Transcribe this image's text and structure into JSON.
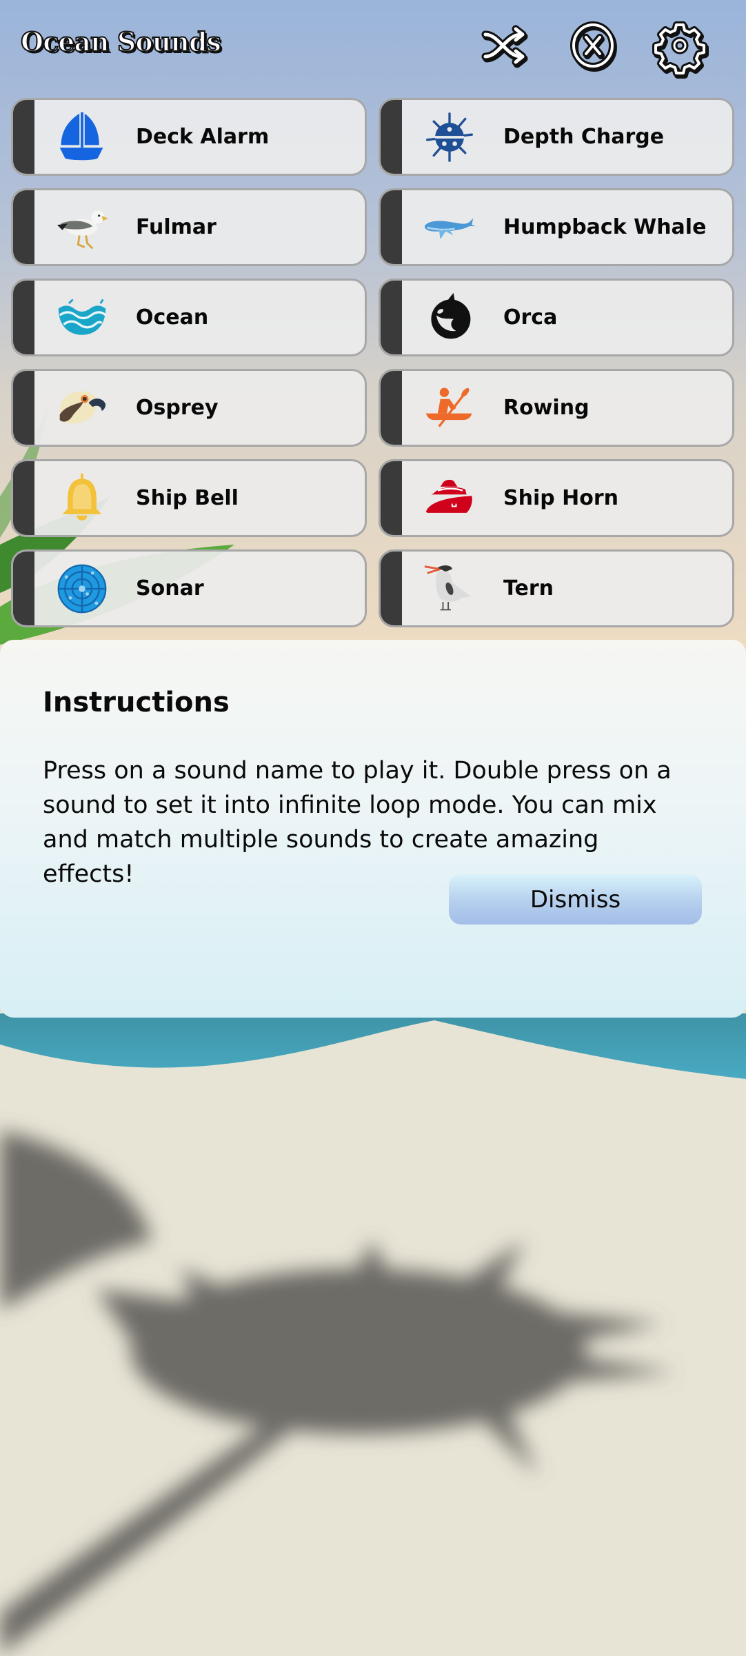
{
  "header": {
    "title": "Ocean Sounds",
    "actions": [
      {
        "name": "shuffle",
        "icon": "shuffle-icon"
      },
      {
        "name": "stop-all",
        "icon": "close-circle-icon"
      },
      {
        "name": "settings",
        "icon": "gear-icon"
      }
    ]
  },
  "sounds": [
    {
      "label": "Deck Alarm",
      "icon": "sailboat-icon",
      "color": "#1565e0"
    },
    {
      "label": "Depth Charge",
      "icon": "naval-mine-icon",
      "color": "#1f4f94"
    },
    {
      "label": "Fulmar",
      "icon": "fulmar-bird-icon",
      "color": "#8a8a8a"
    },
    {
      "label": "Humpback Whale",
      "icon": "whale-icon",
      "color": "#3f8fd0"
    },
    {
      "label": "Ocean",
      "icon": "waves-icon",
      "color": "#1aa6c9"
    },
    {
      "label": "Orca",
      "icon": "orca-icon",
      "color": "#111111"
    },
    {
      "label": "Osprey",
      "icon": "osprey-icon",
      "color": "#5a4636"
    },
    {
      "label": "Rowing",
      "icon": "kayak-icon",
      "color": "#ee6a2a"
    },
    {
      "label": "Ship Bell",
      "icon": "bell-icon",
      "color": "#f3c13a"
    },
    {
      "label": "Ship Horn",
      "icon": "ship-icon",
      "color": "#d0021b"
    },
    {
      "label": "Sonar",
      "icon": "radar-icon",
      "color": "#1f9ae0"
    },
    {
      "label": "Tern",
      "icon": "tern-bird-icon",
      "color": "#9a9a9a"
    }
  ],
  "dialog": {
    "title": "Instructions",
    "body": "Press on a sound name to play it. Double press on a sound to set it into infinite loop mode. You can mix and match multiple sounds to create amazing effects!",
    "dismiss_label": "Dismiss"
  }
}
